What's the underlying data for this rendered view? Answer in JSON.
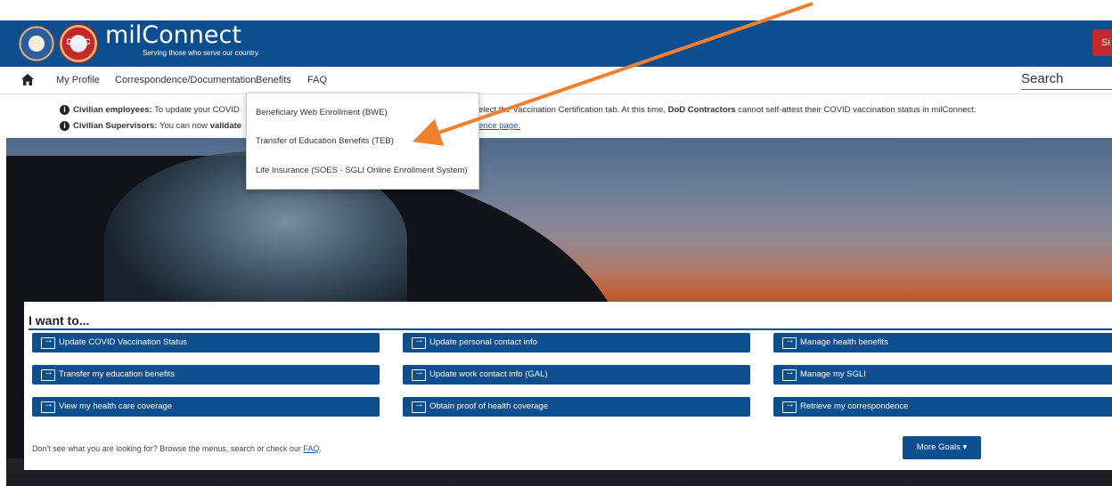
{
  "header": {
    "brand": "milConnect",
    "tagline": "Serving those who serve our country.",
    "seal_dmdc": "DMDC",
    "signin_partial": "Si"
  },
  "nav": {
    "items": [
      "My Profile",
      "Correspondence/Documentation",
      "Benefits",
      "FAQ"
    ],
    "search_label": "Search"
  },
  "notices": {
    "n1_bold": "Civilian employees:",
    "n1_text": " To update your COVID",
    "n1_tail_a": "elect the Vaccination Certification tab. At this time, ",
    "n1_tail_bold": "DoD Contractors",
    "n1_tail_b": " cannot self-attest their COVID vaccination status in milConnect.",
    "n2_bold": "Civilian Supervisors:",
    "n2_text": " You can now ",
    "n2_bold2": "validate",
    "n2_link": "ence page."
  },
  "dropdown": {
    "items": [
      "Beneficiary Web Enrollment (BWE)",
      "Transfer of Education Benefits (TEB)",
      "Life Insurance (SOES - SGLI Online Enrollment System)"
    ]
  },
  "goals": {
    "title": "I want to...",
    "buttons": [
      "Update COVID Vaccination Status",
      "Update personal contact info",
      "Manage health benefits",
      "Transfer my education benefits",
      "Update work contact info (GAL)",
      "Manage my SGLI",
      "View my health care coverage",
      "Obtain proof of health coverage",
      "Retrieve my correspondence"
    ],
    "footer_text": "Don't see what you are looking for? Browse the menus, search or check our ",
    "footer_link": "FAQ",
    "footer_end": ".",
    "more_goals": "More Goals",
    "more_caret": "▾"
  },
  "colors": {
    "header_blue": "#0d4e8f",
    "arrow_orange": "#f07f2e",
    "signin_red": "#c62828"
  }
}
